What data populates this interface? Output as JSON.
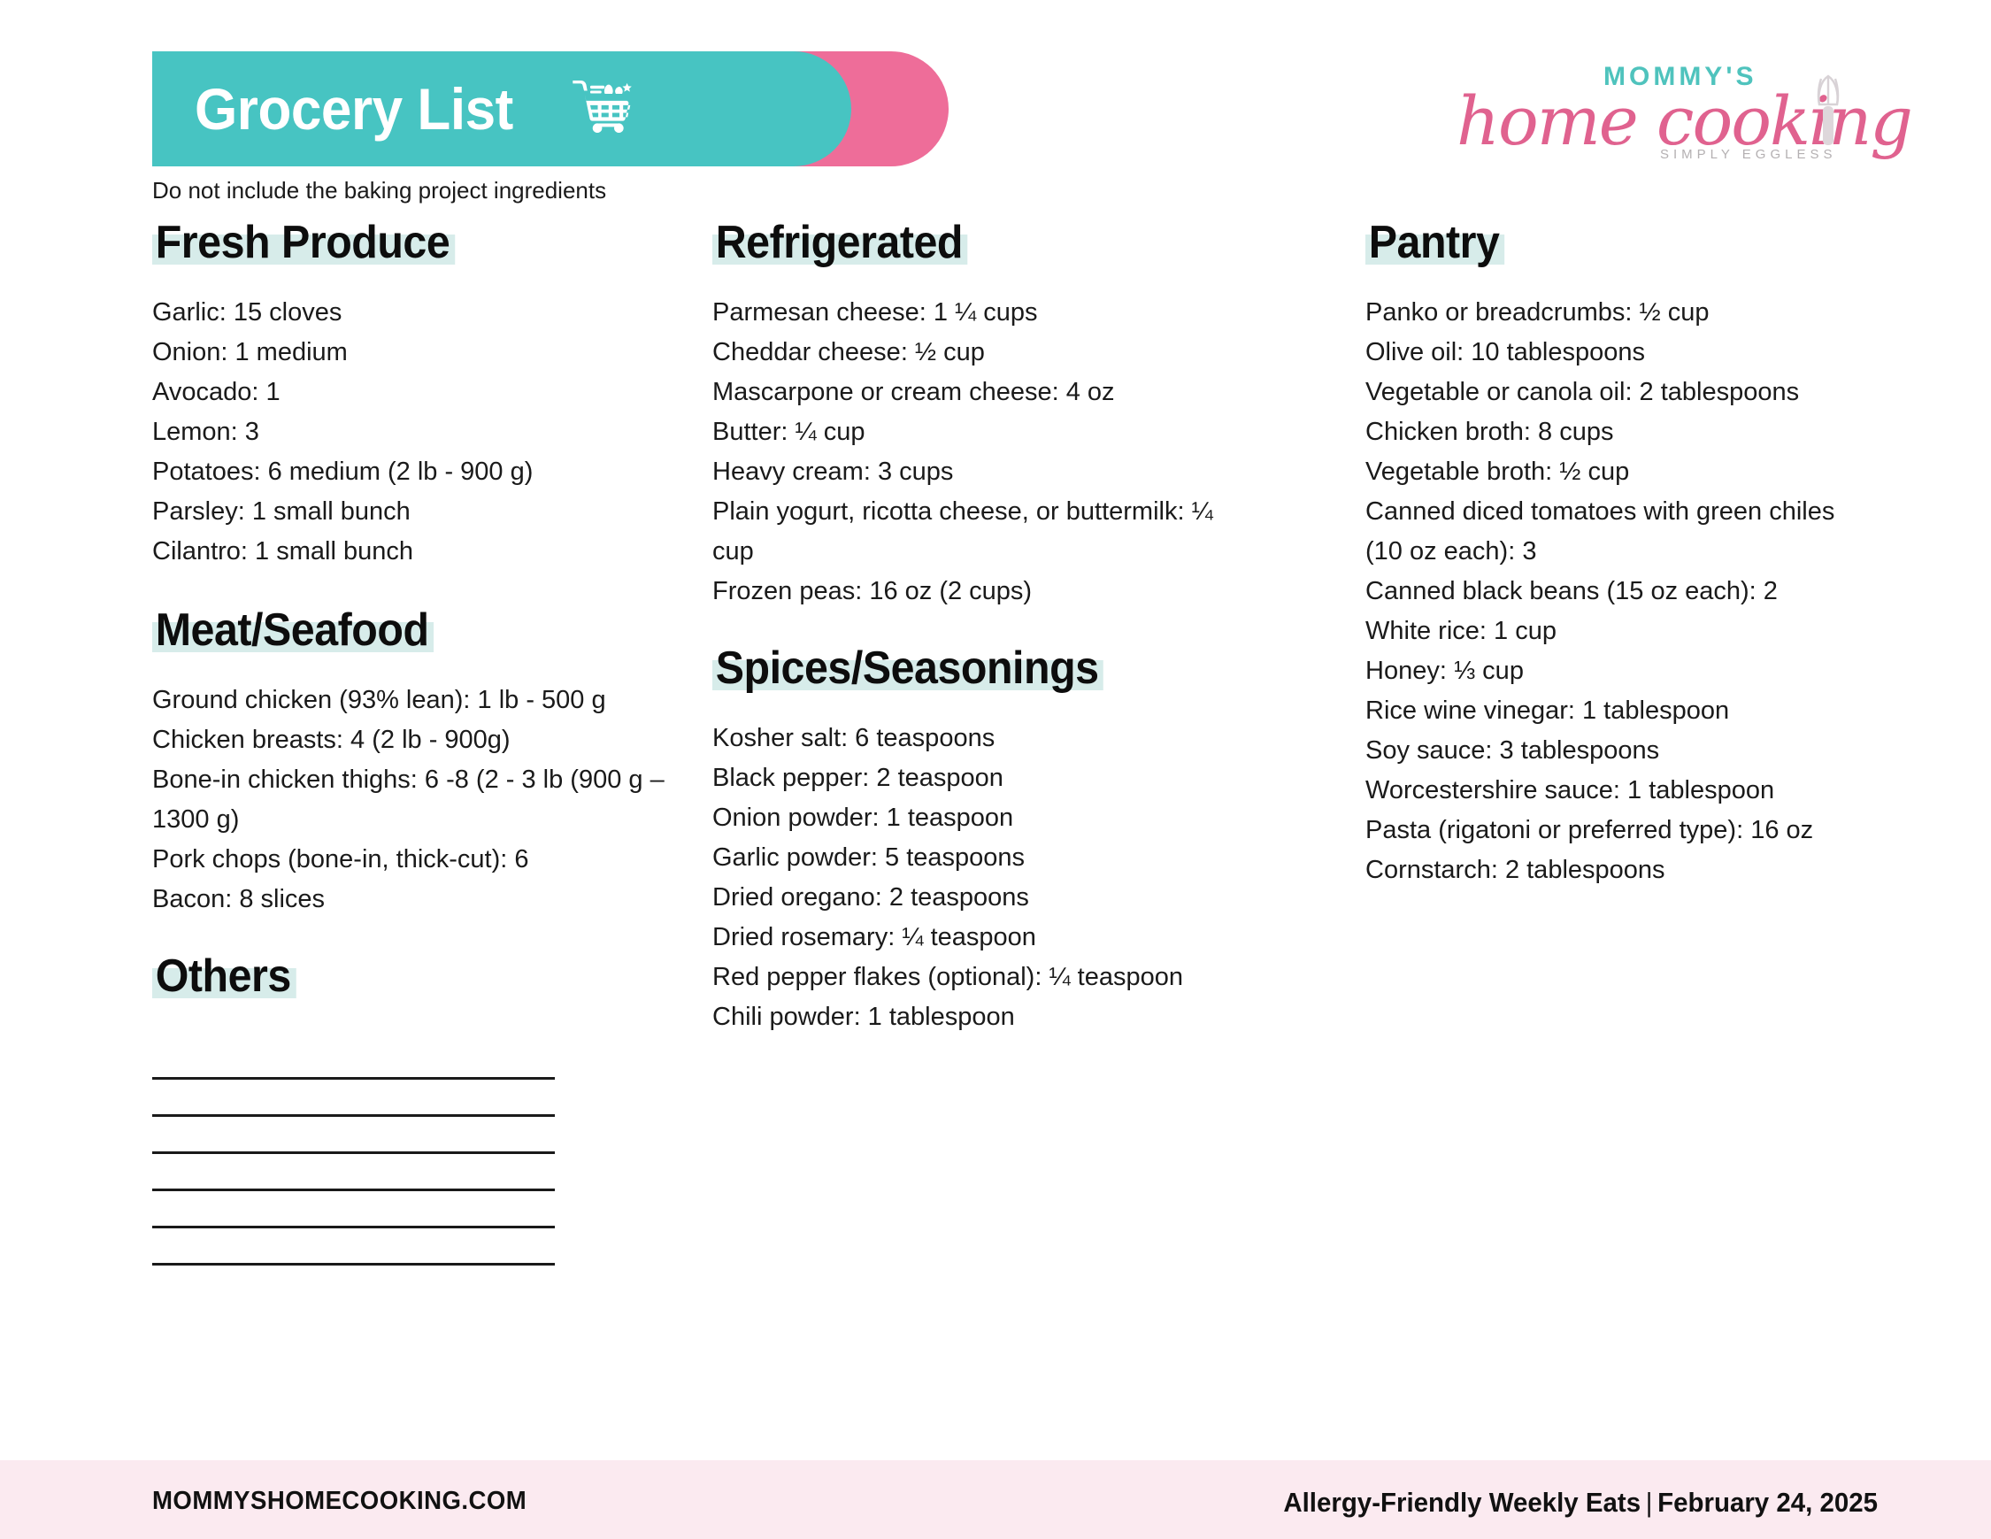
{
  "header": {
    "title": "Grocery List",
    "cart_icon": "shopping-cart-icon",
    "subtitle": "Do not include the baking project ingredients"
  },
  "logo": {
    "top_text": "MOMMY'S",
    "script_text": "home cooking",
    "tagline": "SIMPLY EGGLESS",
    "whisk_icon": "whisk-icon",
    "teal": "#4fc3bd",
    "pink": "#e0628f",
    "gray": "#b4b0b2"
  },
  "theme": {
    "banner_teal": "#47c4c2",
    "banner_pink": "#ee6d99",
    "heading_highlight": "#d7ecea",
    "footer_band": "#fbeaf0"
  },
  "columns": [
    {
      "sections": [
        {
          "heading": "Fresh Produce",
          "items": [
            "Garlic: 15 cloves",
            "Onion: 1 medium",
            "Avocado: 1",
            "Lemon: 3",
            "Potatoes: 6 medium (2 lb - 900 g)",
            "Parsley: 1 small bunch",
            "Cilantro: 1 small bunch"
          ]
        },
        {
          "heading": "Meat/Seafood",
          "items": [
            "Ground chicken (93% lean): 1 lb - 500 g",
            "Chicken breasts: 4 (2 lb - 900g)",
            "Bone-in chicken thighs: 6 -8 (2 - 3 lb (900 g – 1300 g)",
            "Pork chops (bone-in, thick-cut): 6",
            "Bacon: 8 slices"
          ]
        },
        {
          "heading": "Others",
          "items": [],
          "blank_lines": 6
        }
      ]
    },
    {
      "sections": [
        {
          "heading": "Refrigerated",
          "items": [
            "Parmesan cheese: 1 ¼ cups",
            "Cheddar cheese: ½ cup",
            "Mascarpone or cream cheese: 4 oz",
            "Butter: ¼ cup",
            "Heavy cream: 3 cups",
            "Plain yogurt, ricotta cheese, or buttermilk: ¼ cup",
            "Frozen peas: 16 oz (2 cups)"
          ]
        },
        {
          "heading": "Spices/Seasonings",
          "items": [
            "Kosher salt: 6 teaspoons",
            "Black pepper: 2 teaspoon",
            "Onion powder: 1 teaspoon",
            "Garlic powder: 5 teaspoons",
            "Dried oregano: 2 teaspoons",
            "Dried rosemary: ¼ teaspoon",
            "Red pepper flakes (optional): ¼ teaspoon",
            "Chili powder: 1 tablespoon"
          ]
        }
      ]
    },
    {
      "sections": [
        {
          "heading": "Pantry",
          "items": [
            "Panko or breadcrumbs: ½ cup",
            "Olive oil: 10 tablespoons",
            "Vegetable or canola oil: 2 tablespoons",
            "Chicken broth: 8 cups",
            "Vegetable broth: ½ cup",
            "Canned diced tomatoes with green chiles (10 oz each): 3",
            "Canned black beans (15 oz each): 2",
            "White rice: 1 cup",
            "Honey: ⅓ cup",
            "Rice wine vinegar: 1 tablespoon",
            "Soy sauce: 3 tablespoons",
            "Worcestershire sauce: 1 tablespoon",
            "Pasta (rigatoni or preferred type): 16 oz",
            "Cornstarch: 2 tablespoons"
          ]
        }
      ]
    }
  ],
  "footer": {
    "site": "MOMMYSHOMECOOKING.COM",
    "title": "Allergy-Friendly Weekly Eats",
    "separator": "|",
    "date": "February 24, 2025"
  }
}
